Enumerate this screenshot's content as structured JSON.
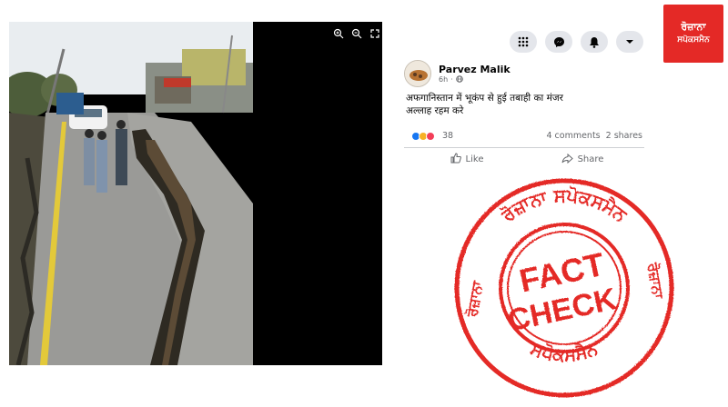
{
  "post": {
    "author": "Parvez Malik",
    "time": "6h",
    "text_line1": "अफगानिस्तान में भूकंप से हुई तबाही का मंजर",
    "text_line2": "अल्लाह रहम करे",
    "reaction_count": "38",
    "comments": "4 comments",
    "shares": "2 shares",
    "like_label": "Like",
    "share_label": "Share"
  },
  "topbar": {
    "icons": [
      "menu-grid-icon",
      "messenger-icon",
      "notifications-bell-icon",
      "account-dropdown-icon"
    ]
  },
  "viewer": {
    "controls": [
      "zoom-in-icon",
      "zoom-out-icon",
      "fullscreen-icon"
    ]
  },
  "logo": {
    "line1": "ਰੋਜ਼ਾਨਾ",
    "line2": "ਸਪੋਕਸਮੈਨ"
  },
  "stamp": {
    "ring_text_top": "ਰੋਜ਼ਾਨਾ ਸਪੋਕਸਮੈਨ",
    "ring_text_left": "ਰੋਜ਼ਾਨਾ",
    "ring_text_right": "ਰੋਜ਼ਾਨਾ",
    "ring_text_bottom": "ਸਪੋਕਸਮੈਨ",
    "word1": "FACT",
    "word2": "CHECK",
    "color": "#e42926"
  }
}
